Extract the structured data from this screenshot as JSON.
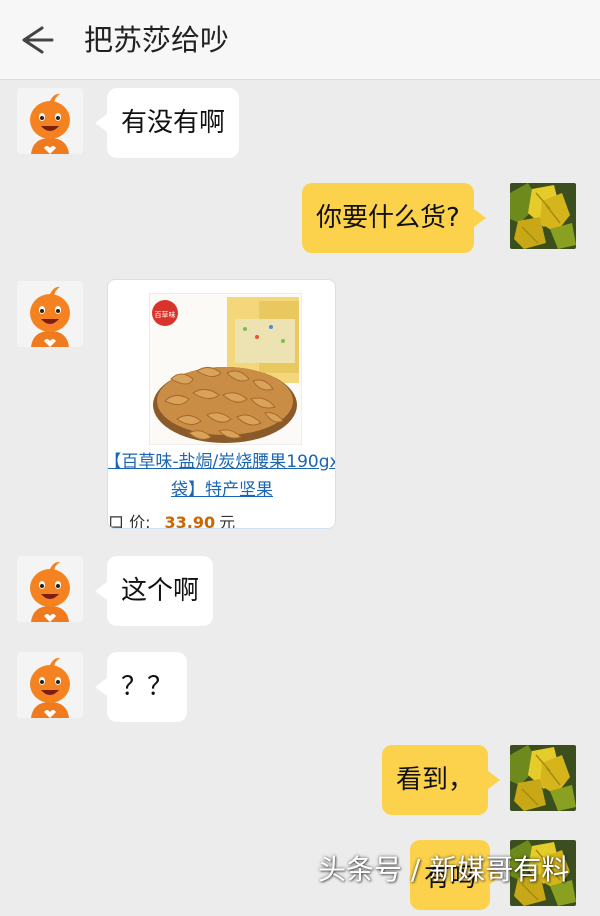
{
  "header": {
    "title": "把苏莎给吵",
    "back_icon": "arrow-left-icon"
  },
  "messages": [
    {
      "side": "left",
      "type": "text",
      "text": "有没有啊"
    },
    {
      "side": "right",
      "type": "text",
      "text": "你要什么货?"
    },
    {
      "side": "left",
      "type": "product",
      "brand_logo": "百草味",
      "name": "【百草味-盐焗/炭烧腰果190gx袋】特产坚果",
      "price_label": "口 价:",
      "price": "33.90",
      "price_unit": "元"
    },
    {
      "side": "left",
      "type": "text",
      "text": "这个啊"
    },
    {
      "side": "left",
      "type": "text",
      "text": "？？"
    },
    {
      "side": "right",
      "type": "text",
      "text": "看到，"
    },
    {
      "side": "right",
      "type": "text",
      "text": "有吗"
    }
  ],
  "watermark": "头条号 / 新媒哥有料",
  "colors": {
    "my_bubble": "#fcd24c",
    "their_bubble": "#ffffff",
    "background": "#ececec",
    "link": "#1a66b3",
    "price": "#cc6600"
  }
}
